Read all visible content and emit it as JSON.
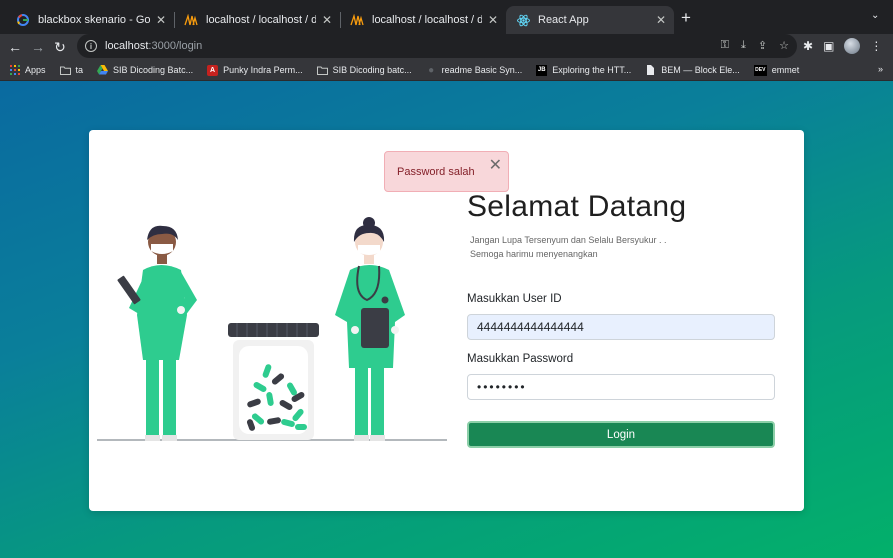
{
  "tabs": [
    {
      "title": "blackbox skenario - Google Pe",
      "icon": "google-icon"
    },
    {
      "title": "localhost / localhost / db_antri",
      "icon": "phpmyadmin-icon"
    },
    {
      "title": "localhost / localhost / db_antri",
      "icon": "phpmyadmin-icon"
    },
    {
      "title": "React App",
      "icon": "react-icon",
      "active": true
    }
  ],
  "address": {
    "host": "localhost",
    "path": ":3000/login"
  },
  "bookmarks": [
    {
      "label": "Apps",
      "icon": "apps-grid-icon"
    },
    {
      "label": "ta",
      "icon": "folder-icon"
    },
    {
      "label": "SIB Dicoding Batc...",
      "icon": "drive-icon"
    },
    {
      "label": "Punky Indra Perm...",
      "icon": "pdf-icon"
    },
    {
      "label": "SIB Dicoding batc...",
      "icon": "folder-icon"
    },
    {
      "label": "readme Basic Syn...",
      "icon": "github-icon"
    },
    {
      "label": "Exploring the HTT...",
      "icon": "jb-icon",
      "icon_text": "JB"
    },
    {
      "label": "BEM — Block Ele...",
      "icon": "bem-icon"
    },
    {
      "label": "emmet",
      "icon": "dev-icon",
      "icon_text": "DEV"
    }
  ],
  "alert": {
    "message": "Password salah",
    "close": "✕"
  },
  "login": {
    "heading": "Selamat Datang",
    "subtitle_line1": "Jangan Lupa Tersenyum dan Selalu Bersyukur . .",
    "subtitle_line2": "Semoga harimu menyenangkan",
    "user_label": "Masukkan User ID",
    "user_value": "4444444444444444",
    "password_label": "Masukkan Password",
    "password_value": "••••••••",
    "button": "Login"
  },
  "colors": {
    "accent_green": "#198754",
    "nurse_green": "#2ecc8f",
    "alert_bg": "#f8d7da",
    "alert_text": "#842029"
  }
}
